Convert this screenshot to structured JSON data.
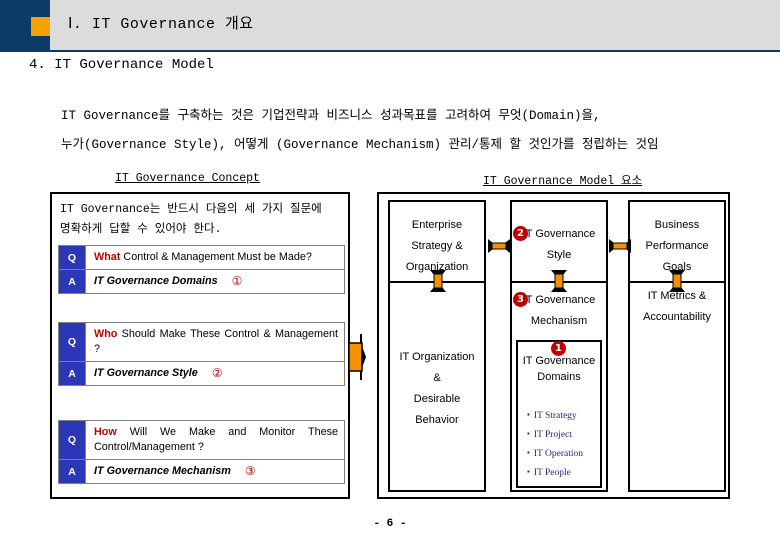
{
  "header": {
    "title": "Ⅰ. IT Governance 개요",
    "navy_color": "#0b3b66",
    "orange_color": "#f5a200",
    "bar_color": "#dcdcdc"
  },
  "section": {
    "title": "4. IT Governance Model",
    "paragraph_line1": "IT Governance를 구축하는 것은 기업전략과 비즈니스 성과목표를 고려하여 무엇(Domain)을,",
    "paragraph_line2": "누가(Governance Style), 어떻게 (Governance Mechanism) 관리/통제 할 것인가를 정립하는 것임"
  },
  "left_panel": {
    "caption": "IT Governance Concept",
    "intro_line1": "IT Governance는 반드시 다음의 세 가지 질문에",
    "intro_line2": "명확하게 답할 수 있어야 한다.",
    "qa": [
      {
        "q_tag": "Q",
        "q_keyword": "What",
        "q_rest": " Control & Management Must be Made?",
        "a_tag": "A",
        "a_text": "IT Governance Domains",
        "a_number": "①"
      },
      {
        "q_tag": "Q",
        "q_keyword": "Who",
        "q_rest": " Should Make These Control & Management ?",
        "a_tag": "A",
        "a_text": "IT Governance Style",
        "a_number": "②"
      },
      {
        "q_tag": "Q",
        "q_keyword": "How",
        "q_rest": " Will We Make and Monitor These Control/Management ?",
        "a_tag": "A",
        "a_text": "IT Governance Mechanism",
        "a_number": "③"
      }
    ],
    "keyword_color": "#c00000",
    "tag_color": "#2b37b7"
  },
  "right_panel": {
    "caption": "IT Governance Model 요소",
    "columns": [
      {
        "top_text": "Enterprise\nStrategy &\nOrganization",
        "bottom_text": "IT Organization\n&\nDesirable\nBehavior"
      },
      {
        "top_text": "IT Governance\nStyle",
        "top_number": "2",
        "bottom_text": "IT Governance\nMechanism",
        "bottom_number": "3"
      },
      {
        "top_text": "Business\nPerformance\nGoals",
        "bottom_text": "IT Metrics &\nAccountability"
      }
    ],
    "domains_box": {
      "number": "1",
      "title": "IT Governance\nDomains",
      "items": [
        "IT Strategy",
        "IT Project",
        "IT Operation",
        "IT People"
      ],
      "item_color": "#1f2a7a"
    },
    "arrow_color": "#f59000",
    "circle_color": "#c00000"
  },
  "footer": {
    "page": "- 6 -"
  }
}
